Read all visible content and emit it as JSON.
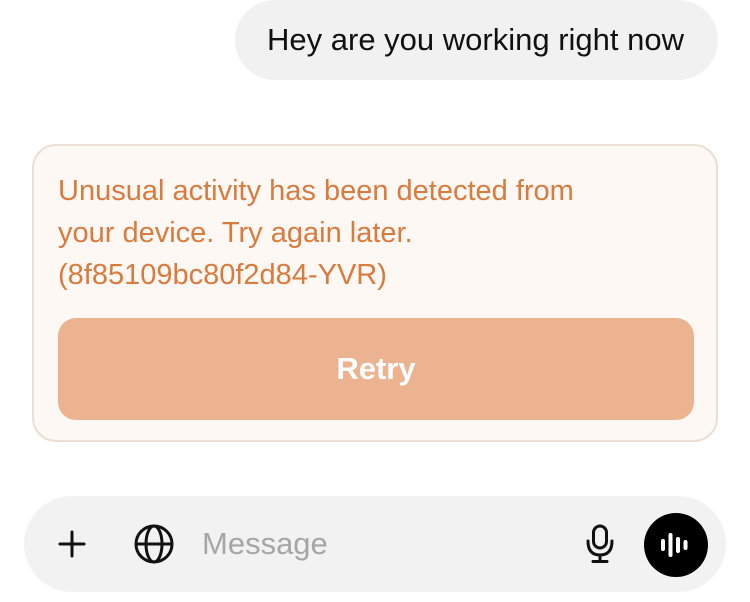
{
  "chat": {
    "user_message": "Hey are you working right now",
    "error": {
      "message_line1": "Unusual activity has been detected from",
      "message_line2": "your device. Try again later.",
      "message_line3": "(8f85109bc80f2d84-YVR)",
      "retry_label": "Retry"
    }
  },
  "composer": {
    "placeholder": "Message",
    "value": "",
    "icons": {
      "add": "plus-icon",
      "web": "globe-icon",
      "dictate": "microphone-icon",
      "voice": "voice-waveform-icon"
    }
  },
  "colors": {
    "error_text": "#d97a3e",
    "error_background": "#fdf8f3",
    "retry_button": "#ecb391",
    "user_bubble": "#f1f1f1",
    "voice_button": "#000000"
  }
}
